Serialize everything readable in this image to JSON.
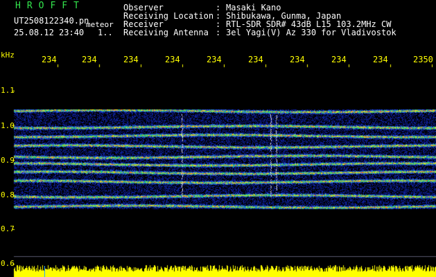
{
  "header": {
    "brand": "HROFFT",
    "filename": "UT2508122340.pn",
    "tag": "meteor",
    "datetime": "25.08.12 23:40",
    "counter": "1..",
    "fields": [
      {
        "label": "Observer",
        "sep": ":",
        "value": "Masaki Kano"
      },
      {
        "label": "Receiving Location",
        "sep": ":",
        "value": "Shibukawa, Gunma, Japan"
      },
      {
        "label": "Receiver",
        "sep": ":",
        "value": "RTL-SDR SDR# 43dB L15 103.2MHz CW"
      },
      {
        "label": "Receiving Antenna",
        "sep": ":",
        "value": "3el Yagi(V) Az 330 for Vladivostok"
      }
    ]
  },
  "x_axis": {
    "ticks": [
      "234",
      "234",
      "234",
      "234",
      "234",
      "234",
      "234",
      "234",
      "234",
      "2350"
    ]
  },
  "y_axis": {
    "unit": "kHz",
    "ticks": [
      "1.1",
      "1.0",
      "0.9",
      "0.8",
      "0.7",
      "0.6"
    ]
  },
  "colors": {
    "text": "#ffffff",
    "brand": "#33e64d",
    "axis": "#ffff00",
    "background": "#000000",
    "signal_low": "#0a1ea0",
    "signal_high": "#ff3030",
    "power_trace": "#ffff00"
  }
}
